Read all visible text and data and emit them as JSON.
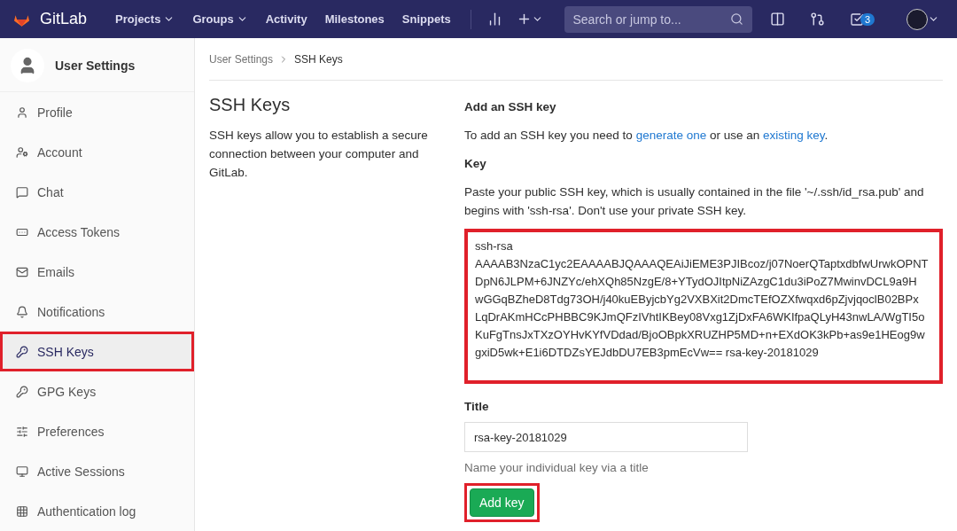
{
  "navbar": {
    "brand": "GitLab",
    "links": [
      {
        "label": "Projects",
        "dropdown": true
      },
      {
        "label": "Groups",
        "dropdown": true
      },
      {
        "label": "Activity",
        "dropdown": false
      },
      {
        "label": "Milestones",
        "dropdown": false
      },
      {
        "label": "Snippets",
        "dropdown": false
      }
    ],
    "search": {
      "placeholder": "Search or jump to..."
    },
    "todo_count": "3"
  },
  "sidebar": {
    "title": "User Settings",
    "items": [
      {
        "label": "Profile",
        "selected": false,
        "highlighted": false
      },
      {
        "label": "Account",
        "selected": false,
        "highlighted": false
      },
      {
        "label": "Chat",
        "selected": false,
        "highlighted": false
      },
      {
        "label": "Access Tokens",
        "selected": false,
        "highlighted": false
      },
      {
        "label": "Emails",
        "selected": false,
        "highlighted": false
      },
      {
        "label": "Notifications",
        "selected": false,
        "highlighted": false
      },
      {
        "label": "SSH Keys",
        "selected": true,
        "highlighted": true
      },
      {
        "label": "GPG Keys",
        "selected": false,
        "highlighted": false
      },
      {
        "label": "Preferences",
        "selected": false,
        "highlighted": false
      },
      {
        "label": "Active Sessions",
        "selected": false,
        "highlighted": false
      },
      {
        "label": "Authentication log",
        "selected": false,
        "highlighted": false
      }
    ]
  },
  "breadcrumbs": [
    "User Settings",
    "SSH Keys"
  ],
  "intro": {
    "title": "SSH Keys",
    "text": "SSH keys allow you to establish a secure connection between your computer and GitLab."
  },
  "form": {
    "heading": "Add an SSH key",
    "help_before": "To add an SSH key you need to ",
    "link_1": "generate one",
    "help_middle": " or use an ",
    "link_2": "existing key",
    "help_after": ".",
    "key_label": "Key",
    "key_help": "Paste your public SSH key, which is usually contained in the file '~/.ssh/id_rsa.pub' and begins with 'ssh-rsa'. Don't use your private SSH key.",
    "key_lines": [
      "ssh-rsa",
      "AAAAB3NzaC1yc2EAAAABJQAAAQEAiJiEME3PJIBcoz/j07NoerQTaptxdbfwUrwkOPNT",
      "DpN6JLPM+6JNZYc/ehXQh85NzgE/8+YTydOJItpNiZAzgC1du3iPoZ7MwinvDCL9a9H",
      "wGGqBZheD8Tdg73OH/j40kuEByjcbYg2VXBXit2DmcTEfOZXfwqxd6pZjvjqoclB02BPx",
      "LqDrAKmHCcPHBBC9KJmQFzIVhtIKBey08Vxg1ZjDxFA6WKIfpaQLyH43nwLA/WgTI5o",
      "KuFgTnsJxTXzOYHvKYfVDdad/BjoOBpkXRUZHP5MD+n+EXdOK3kPb+as9e1HEog9w",
      "gxiD5wk+E1i6DTDZsYEJdbDU7EB3pmEcVw== rsa-key-20181029"
    ],
    "key_highlighted": true,
    "title_label": "Title",
    "title_value": "rsa-key-20181029",
    "title_help": "Name your individual key via a title",
    "submit": "Add key",
    "submit_highlighted": true
  }
}
